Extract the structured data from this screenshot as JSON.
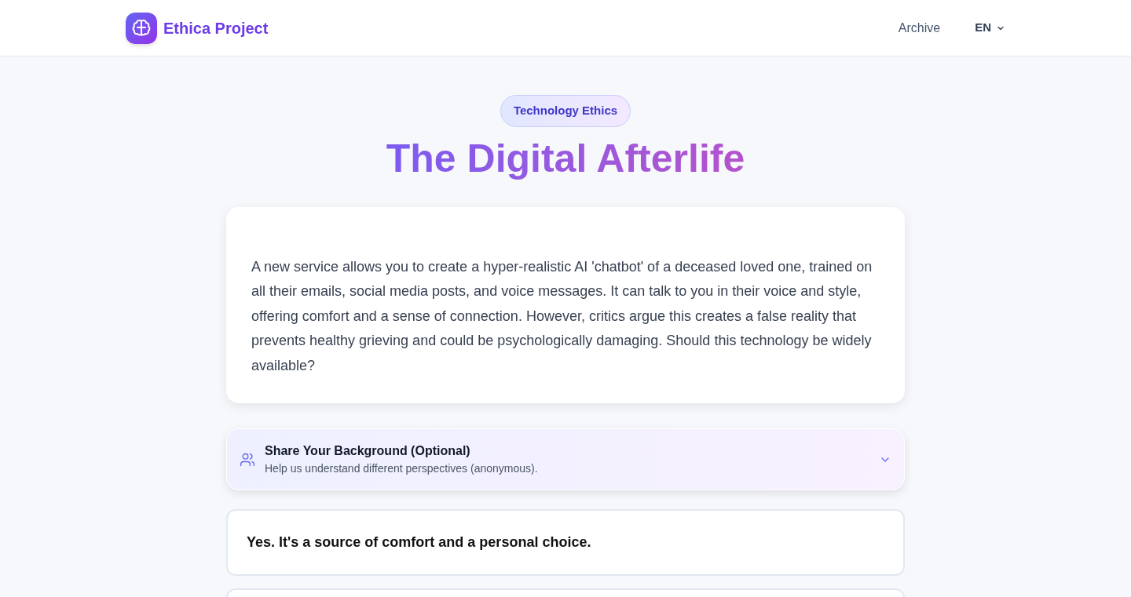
{
  "header": {
    "brand": "Ethica Project",
    "nav": [
      {
        "label": "Archive"
      }
    ],
    "language": "EN"
  },
  "badge": "Technology Ethics",
  "title": "The Digital Afterlife",
  "scenario": "A new service allows you to create a hyper-realistic AI 'chatbot' of a deceased loved one, trained on all their emails, social media posts, and voice messages. It can talk to you in their voice and style, offering comfort and a sense of connection. However, critics argue this creates a false reality that prevents healthy grieving and could be psychologically damaging. Should this technology be widely available?",
  "background_panel": {
    "title": "Share Your Background (Optional)",
    "subtitle": "Help us understand different perspectives (anonymous).",
    "expanded": false
  },
  "options": [
    {
      "label": "Yes. It's a source of comfort and a personal choice.",
      "selected": false
    }
  ]
}
